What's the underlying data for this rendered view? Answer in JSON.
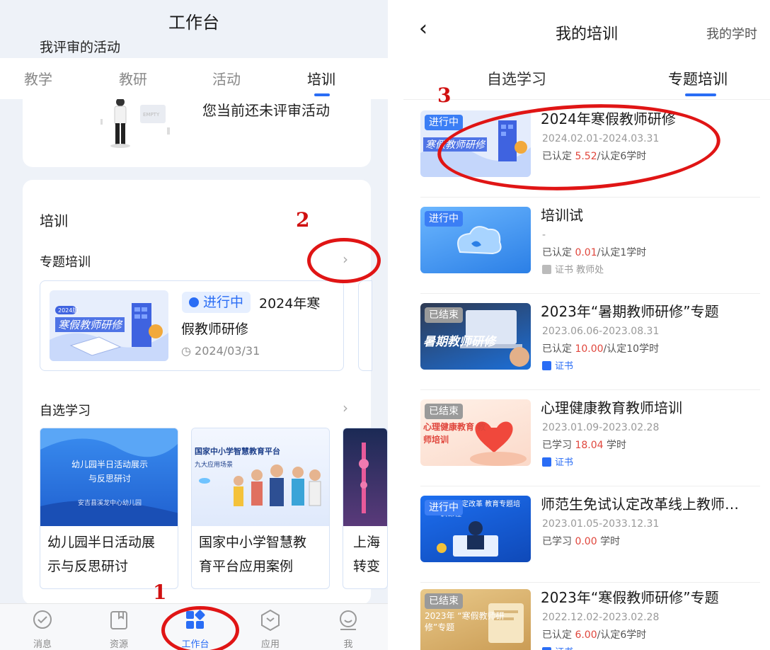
{
  "left": {
    "title": "工作台",
    "subheader": "我评审的活动",
    "tabs": [
      "教学",
      "教研",
      "活动",
      "培训"
    ],
    "empty_text": "您当前还未评审活动",
    "section_title": "培训",
    "topic_row": "专题培训",
    "topic": {
      "status": "进行中",
      "name_line1": "2024年寒",
      "name_line2": "假教师研修",
      "date": "2024/03/31",
      "cover_tag": "2024版",
      "cover_text": "寒假教师研修"
    },
    "self_row": "自选学习",
    "courses": [
      {
        "line1": "幼儿园半日活动展",
        "line2": "示与反思研讨",
        "img_line1": "幼儿园半日活动展示",
        "img_line2": "与反思研讨",
        "img_line3": "安吉县溪龙中心幼儿园"
      },
      {
        "line1": "国家中小学智慧教",
        "line2": "育平台应用案例",
        "img_line1": "国家中小学智慧教育平台",
        "img_line2": "九大应用场景"
      },
      {
        "line1": "上海",
        "line2": "转变"
      }
    ],
    "nav": [
      "消息",
      "资源",
      "工作台",
      "应用",
      "我"
    ],
    "chevron": "›"
  },
  "right": {
    "back": "‹",
    "title": "我的培训",
    "title_right": "我的学时",
    "tabs": [
      "自选学习",
      "专题培训"
    ],
    "items": [
      {
        "badge": "进行中",
        "title": "2024年寒假教师研修",
        "date": "2024.02.01-2024.03.31",
        "credit_pre": "已认定 ",
        "credit_num": "5.52",
        "credit_post": "/认定6学时",
        "meta": "",
        "cover_text": "寒假教师研修"
      },
      {
        "badge": "进行中",
        "title": "培训试",
        "date": "-",
        "credit_pre": "已认定 ",
        "credit_num": "0.01",
        "credit_post": "/认定1学时",
        "meta": "证书   教师处",
        "cover_text": ""
      },
      {
        "badge": "已结束",
        "title": "2023年“暑期教师研修”专题",
        "date": "2023.06.06-2023.08.31",
        "credit_pre": "已认定 ",
        "credit_num": "10.00",
        "credit_post": "/认定10学时",
        "meta": "证书",
        "cover_text": "暑期教师研修"
      },
      {
        "badge": "已结束",
        "title": "心理健康教育教师培训",
        "date": "2023.01.09-2023.02.28",
        "credit_pre": "已学习 ",
        "credit_num": "18.04",
        "credit_post": " 学时",
        "meta": "证书",
        "cover_text": "心理健康教育 教师培训"
      },
      {
        "badge": "进行中",
        "title": "师范生免试认定改革线上教师…",
        "date": "2023.01.05-2033.12.31",
        "credit_pre": "已学习 ",
        "credit_num": "0.00",
        "credit_post": " 学时",
        "meta": "",
        "cover_text": "免试认定改革 教育专题培训课程"
      },
      {
        "badge": "已结束",
        "title": "2023年“寒假教师研修”专题",
        "date": "2022.12.02-2023.02.28",
        "credit_pre": "已认定 ",
        "credit_num": "6.00",
        "credit_post": "/认定6学时",
        "meta": "证书",
        "cover_text": "2023年 “寒假教师研修”专题"
      }
    ]
  },
  "annotations": [
    "1",
    "2",
    "3"
  ],
  "colors": {
    "accent": "#2a6df5",
    "annotation": "#e01515",
    "credit_num": "#e0463c",
    "ongoing_badge": "#3b7ef5",
    "ended_badge": "#9a9a9a"
  }
}
